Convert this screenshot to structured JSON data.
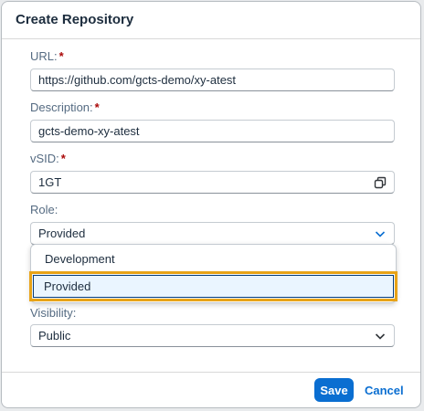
{
  "dialog": {
    "title": "Create Repository"
  },
  "form": {
    "url": {
      "label": "URL:",
      "required": "*",
      "value": "https://github.com/gcts-demo/xy-atest"
    },
    "description": {
      "label": "Description:",
      "required": "*",
      "value": "gcts-demo-xy-atest"
    },
    "vsid": {
      "label": "vSID:",
      "required": "*",
      "value": "1GT",
      "icon": "value-help-icon"
    },
    "role": {
      "label": "Role:",
      "value": "Provided",
      "icon": "chevron-down-icon"
    },
    "visibility": {
      "label": "Visibility:",
      "value": "Public",
      "icon": "chevron-down-icon"
    }
  },
  "role_dropdown": {
    "options": [
      "Development",
      "Provided"
    ],
    "selected": "Provided"
  },
  "footer": {
    "save_label": "Save",
    "cancel_label": "Cancel"
  },
  "colors": {
    "accent": "#0a6ed1",
    "required": "#aa0808",
    "focus_highlight": "#e8a317",
    "selected_bg": "#eaf5ff"
  }
}
